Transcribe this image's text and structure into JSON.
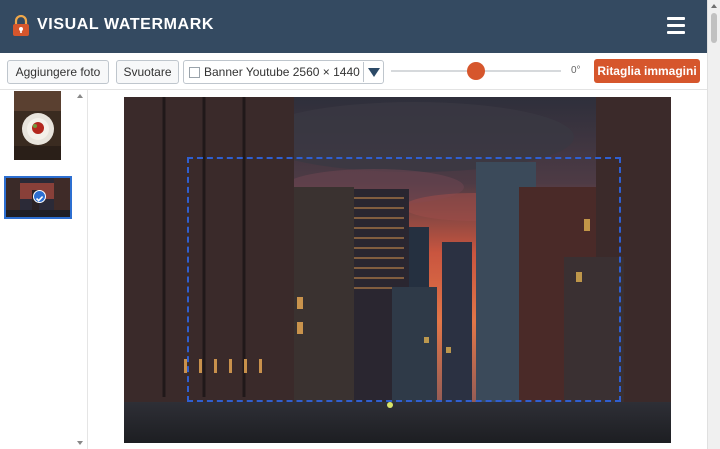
{
  "app": {
    "title": "VISUAL WATERMARK"
  },
  "toolbar": {
    "add_photo_label": "Aggiungere foto",
    "clear_label": "Svuotare",
    "crop_preset": "Banner Youtube 2560 × 1440",
    "rotation_value": "0°",
    "crop_button_label": "Ritaglia immagini"
  },
  "colors": {
    "header": "#344a61",
    "accent": "#d6562c",
    "selection": "#2d6fd1"
  }
}
